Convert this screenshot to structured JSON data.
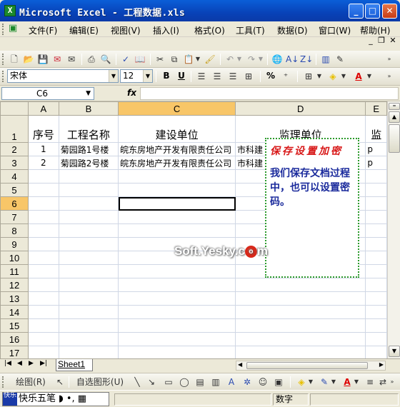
{
  "window": {
    "title": "Microsoft Excel - 工程数据.xls",
    "app_icon": "X"
  },
  "menu": {
    "items": [
      "文件(F)",
      "编辑(E)",
      "视图(V)",
      "插入(I)",
      "格式(O)",
      "工具(T)",
      "数据(D)",
      "窗口(W)",
      "帮助(H)"
    ]
  },
  "format_toolbar": {
    "font": "宋体",
    "size": "12",
    "bold": "B",
    "underline": "U",
    "percent": "%"
  },
  "formula_bar": {
    "name_box": "C6",
    "fx": "fx",
    "formula": ""
  },
  "columns": [
    "A",
    "B",
    "C",
    "D",
    "E"
  ],
  "rows": [
    "1",
    "2",
    "3",
    "4",
    "5",
    "6",
    "7",
    "8",
    "9",
    "10",
    "11",
    "12",
    "13",
    "14",
    "15",
    "16",
    "17"
  ],
  "sheet": {
    "headers": [
      "序号",
      "工程名称",
      "建设单位",
      "监理单位",
      "监"
    ],
    "data": [
      [
        "1",
        "菊园路1号楼",
        "皖东房地产开发有限责任公司",
        "市科建",
        "p"
      ],
      [
        "2",
        "菊园路2号楼",
        "皖东房地产开发有限责任公司",
        "市科建",
        "p"
      ]
    ]
  },
  "comment": {
    "title": "保存设置加密",
    "body": "我们保存文档过程中，也可以设置密码。"
  },
  "watermark": {
    "text_before": "Soft.Yesky.c",
    "dot": "o",
    "text_after": "m"
  },
  "tabs": {
    "sheet1": "Sheet1"
  },
  "drawing_toolbar": {
    "draw": "绘图(R)",
    "autoshape": "自选图形(U)"
  },
  "status": {
    "ime": "快乐五笔",
    "mode": "数字"
  }
}
